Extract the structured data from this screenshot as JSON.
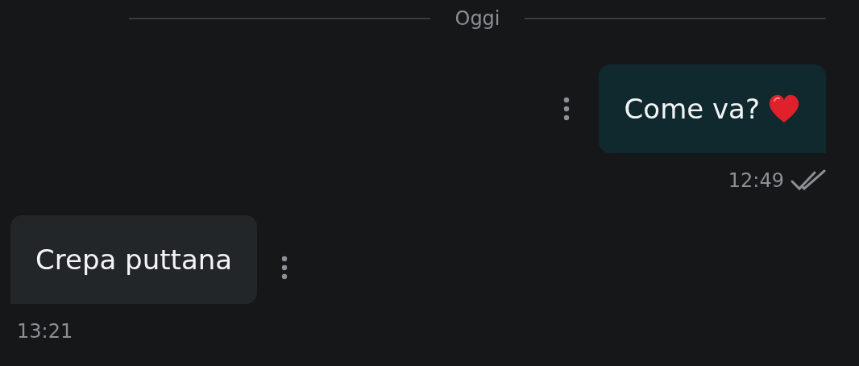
{
  "date_divider": "Oggi",
  "messages": [
    {
      "kind": "sent",
      "text": "Come va?",
      "time": "12:49",
      "heart": true
    },
    {
      "kind": "received",
      "text": "Crepa puttana",
      "time": "13:21",
      "heart": false
    }
  ]
}
